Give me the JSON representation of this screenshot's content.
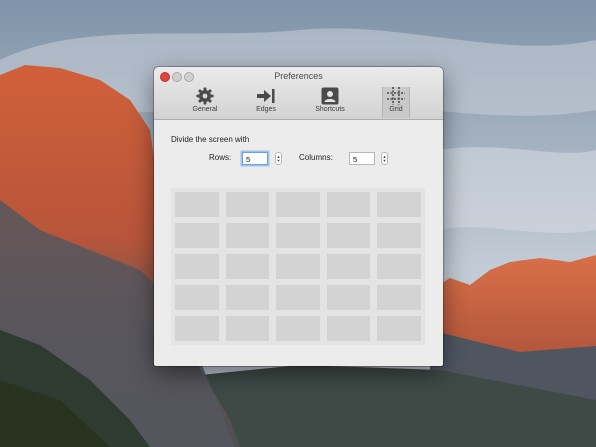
{
  "window": {
    "title": "Preferences",
    "controls": [
      "close",
      "minimize",
      "zoom"
    ]
  },
  "toolbar": {
    "tabs": [
      {
        "label": "General",
        "icon": "gear-icon",
        "selected": false
      },
      {
        "label": "Edges",
        "icon": "arrow-to-edge-icon",
        "selected": false
      },
      {
        "label": "Shortcuts",
        "icon": "person-card-icon",
        "selected": false
      },
      {
        "label": "Grid",
        "icon": "grid-icon",
        "selected": true
      }
    ]
  },
  "grid_settings": {
    "heading": "Divide the screen with",
    "rows_label": "Rows:",
    "rows_value": "5",
    "columns_label": "Columns:",
    "columns_value": "5",
    "preview_rows": 5,
    "preview_columns": 5
  },
  "colors": {
    "window_bg": "#ececec",
    "cell": "#d3d3d3",
    "close_button": "#e0443e",
    "focus_ring": "#6aa3e0"
  }
}
